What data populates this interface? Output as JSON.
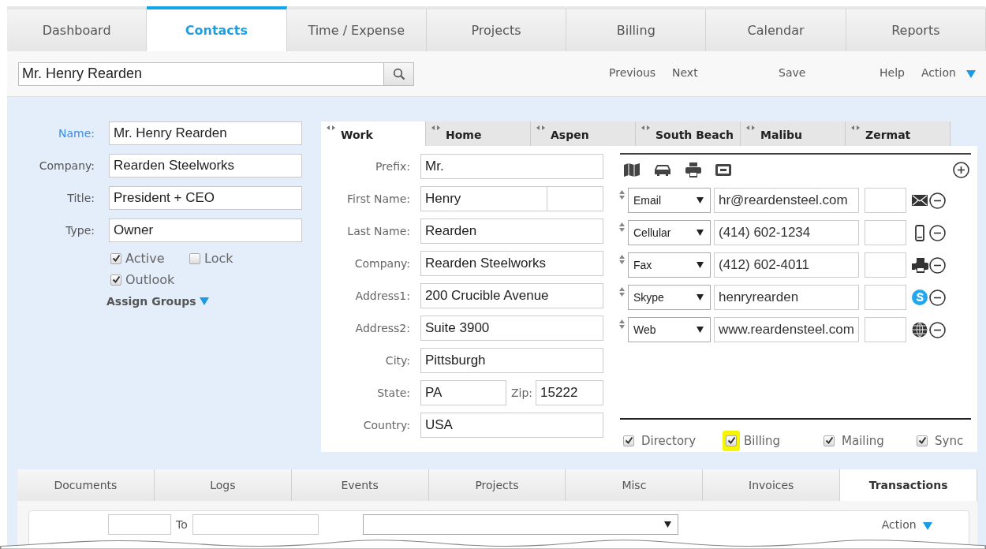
{
  "nav_tabs": [
    {
      "label": "Dashboard",
      "selected": false
    },
    {
      "label": "Contacts",
      "selected": true
    },
    {
      "label": "Time / Expense",
      "selected": false
    },
    {
      "label": "Projects",
      "selected": false
    },
    {
      "label": "Billing",
      "selected": false
    },
    {
      "label": "Calendar",
      "selected": false
    },
    {
      "label": "Reports",
      "selected": false
    }
  ],
  "toolbar": {
    "search_value": "Mr. Henry Rearden",
    "links": [
      "Previous",
      "Next",
      "Save",
      "Help"
    ],
    "action": "Action"
  },
  "contact_fields": [
    {
      "label": "Name:",
      "value": "Mr. Henry Rearden",
      "focused": true
    },
    {
      "label": "Company:",
      "value": "Rearden Steelworks",
      "focused": false
    },
    {
      "label": "Title:",
      "value": "President + CEO",
      "focused": false
    },
    {
      "label": "Type:",
      "value": "Owner",
      "focused": false
    }
  ],
  "contact_options": [
    {
      "label": "Active",
      "checked": true
    },
    {
      "label": "Lock",
      "checked": false
    },
    {
      "label": "Outlook",
      "checked": true
    }
  ],
  "assign_groups": "Assign Groups",
  "address_tabs": [
    {
      "label": "Work",
      "selected": true
    },
    {
      "label": "Home",
      "selected": false
    },
    {
      "label": "Aspen",
      "selected": false
    },
    {
      "label": "South Beach",
      "selected": false
    },
    {
      "label": "Malibu",
      "selected": false
    },
    {
      "label": "Zermat",
      "selected": false
    }
  ],
  "address_fields": [
    {
      "kind": "text",
      "label": "Prefix:",
      "value": "Mr."
    },
    {
      "kind": "split",
      "label": "First Name:",
      "value": "Henry"
    },
    {
      "kind": "text",
      "label": "Last Name:",
      "value": "Rearden"
    },
    {
      "kind": "text",
      "label": "Company:",
      "value": "Rearden Steelworks"
    },
    {
      "kind": "text",
      "label": "Address1:",
      "value": "200 Crucible Avenue"
    },
    {
      "kind": "text",
      "label": "Address2:",
      "value": "Suite 3900"
    },
    {
      "kind": "text",
      "label": "City:",
      "value": "Pittsburgh"
    },
    {
      "kind": "pair",
      "label": "State:",
      "value": "PA",
      "label2": "Zip:",
      "value2": "15222"
    },
    {
      "kind": "text",
      "label": "Country:",
      "value": "USA"
    }
  ],
  "channels": [
    {
      "kind": "email",
      "type": "Email",
      "value": "hr@reardensteel.com"
    },
    {
      "kind": "mobile",
      "type": "Cellular",
      "value": "(414) 602-1234"
    },
    {
      "kind": "fax",
      "type": "Fax",
      "value": "(412) 602-4011"
    },
    {
      "kind": "skype",
      "type": "Skype",
      "value": "henryrearden"
    },
    {
      "kind": "web",
      "type": "Web",
      "value": "www.reardensteel.com"
    }
  ],
  "flags": [
    {
      "label": "Directory",
      "checked": true,
      "highlighted": false
    },
    {
      "label": "Billing",
      "checked": true,
      "highlighted": true
    },
    {
      "label": "Mailing",
      "checked": true,
      "highlighted": false
    },
    {
      "label": "Sync",
      "checked": true,
      "highlighted": false
    }
  ],
  "bottom_tabs": [
    {
      "label": "Documents",
      "selected": false
    },
    {
      "label": "Logs",
      "selected": false
    },
    {
      "label": "Events",
      "selected": false
    },
    {
      "label": "Projects",
      "selected": false
    },
    {
      "label": "Misc",
      "selected": false
    },
    {
      "label": "Invoices",
      "selected": false
    },
    {
      "label": "Transactions",
      "selected": true
    }
  ],
  "filter": {
    "to_label": "To",
    "action": "Action"
  }
}
